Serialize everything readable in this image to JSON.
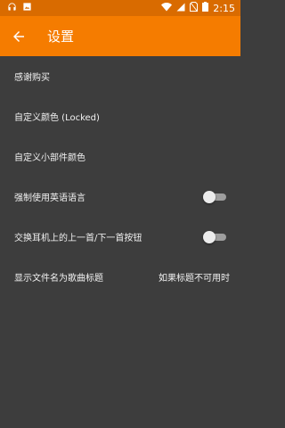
{
  "status_bar": {
    "time": "2:15",
    "left_icons": [
      "headphones-icon",
      "image-icon"
    ],
    "right_icons": [
      "wifi-icon",
      "signal-icon",
      "no-sim-icon",
      "battery-icon"
    ]
  },
  "app_bar": {
    "title": "设置",
    "back_icon": "arrow-back-icon"
  },
  "settings": [
    {
      "label": "感谢购买"
    },
    {
      "label": "自定义颜色 (Locked)"
    },
    {
      "label": "自定义小部件颜色"
    },
    {
      "label": "强制使用英语语言",
      "toggle": false
    },
    {
      "label": "交换耳机上的上一首/下一首按钮",
      "toggle": false
    },
    {
      "label": "显示文件名为歌曲标题",
      "value": "如果标题不可用时"
    }
  ],
  "colors": {
    "accent": "#f57c00",
    "status_bar": "#d96b00",
    "background": "#3d3d3d"
  }
}
